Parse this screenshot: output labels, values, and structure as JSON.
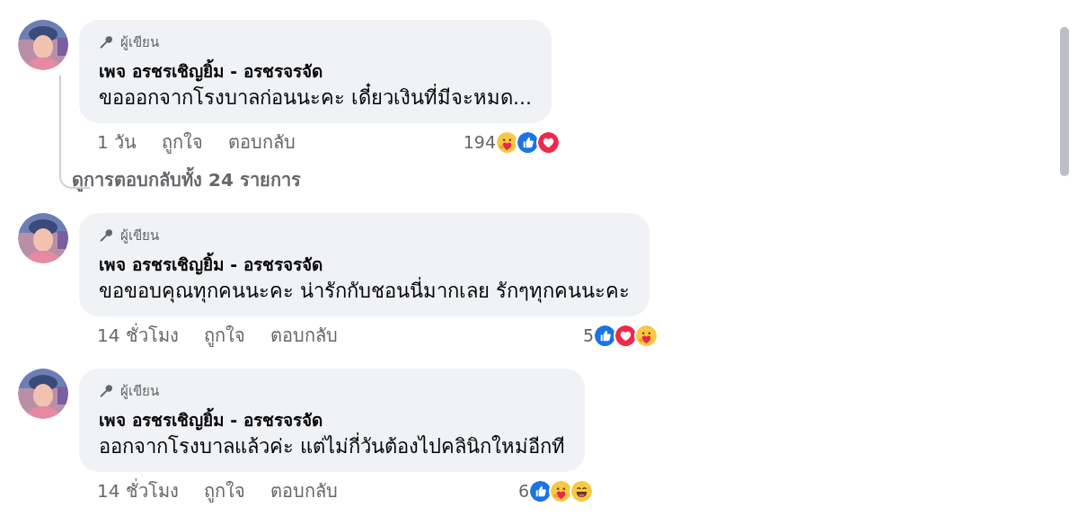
{
  "comments": [
    {
      "badge": "ผู้เขียน",
      "author": "เพจ อรชรเชิญยิ้ม - อรชรจรจัด",
      "text": "ขอออกจากโรงบาลก่อนนะคะ เดี๋ยวเงินที่มีจะหมด...",
      "time": "1 วัน",
      "like_label": "ถูกใจ",
      "reply_label": "ตอบกลับ",
      "reaction_count": "194",
      "reactions": [
        {
          "kind": "care"
        },
        {
          "kind": "like"
        },
        {
          "kind": "love"
        }
      ],
      "view_replies": "ดูการตอบกลับทั้ง 24 รายการ"
    },
    {
      "badge": "ผู้เขียน",
      "author": "เพจ อรชรเชิญยิ้ม - อรชรจรจัด",
      "text": "ขอขอบคุณทุกคนนะคะ น่ารักกับชอนนี่มากเลย รักๆทุกคนนะคะ",
      "time": "14 ชั่วโมง",
      "like_label": "ถูกใจ",
      "reply_label": "ตอบกลับ",
      "reaction_count": "5",
      "reactions": [
        {
          "kind": "like"
        },
        {
          "kind": "love"
        },
        {
          "kind": "care"
        }
      ]
    },
    {
      "badge": "ผู้เขียน",
      "author": "เพจ อรชรเชิญยิ้ม - อรชรจรจัด",
      "text": "ออกจากโรงบาลแล้วค่ะ แต่ไม่กี่วันต้องไปคลินิกใหม่อีกที",
      "time": "14 ชั่วโมง",
      "like_label": "ถูกใจ",
      "reply_label": "ตอบกลับ",
      "reaction_count": "6",
      "reactions": [
        {
          "kind": "like"
        },
        {
          "kind": "care"
        },
        {
          "kind": "haha"
        }
      ]
    }
  ]
}
